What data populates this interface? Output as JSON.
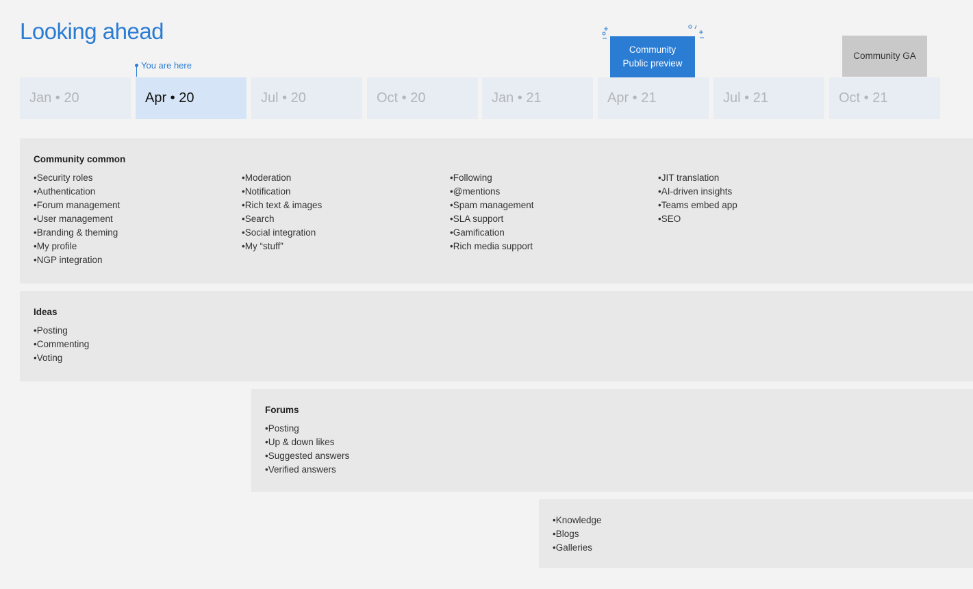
{
  "title": "Looking ahead",
  "timeline": {
    "periods": [
      "Jan • 20",
      "Apr • 20",
      "Jul • 20",
      "Oct • 20",
      "Jan • 21",
      "Apr • 21",
      "Jul • 21",
      "Oct • 21"
    ],
    "current_period": "Apr • 20",
    "you_are_here": "You are here"
  },
  "milestones": {
    "preview": {
      "label": "Community Public preview",
      "color": "#2b7cd3"
    },
    "ga": {
      "label": "Community GA",
      "color": "#c9c9c9"
    }
  },
  "community_common": {
    "title": "Community common",
    "col1": [
      "Security roles",
      "Authentication",
      "Forum management",
      "User management",
      "Branding & theming",
      "My profile",
      "NGP integration"
    ],
    "col2": [
      "Moderation",
      "Notification",
      "Rich text & images",
      "Search",
      "Social integration",
      "My “stuff”"
    ],
    "col3": [
      "Following",
      "@mentions",
      "Spam management",
      "SLA support",
      "Gamification",
      "Rich media support"
    ],
    "col4": [
      "JIT translation",
      "AI-driven insights",
      "Teams embed app",
      "SEO"
    ]
  },
  "ideas": {
    "title": "Ideas",
    "items": [
      "Posting",
      "Commenting",
      "Voting"
    ]
  },
  "forums": {
    "title": "Forums",
    "items": [
      "Posting",
      "Up & down likes",
      "Suggested answers",
      "Verified answers"
    ]
  },
  "content": {
    "items": [
      "Knowledge",
      "Blogs",
      "Galleries"
    ]
  },
  "colors": {
    "accent": "#2b7cd3",
    "band": "#e8e8e8",
    "timeline_cell": "#e8edf3",
    "timeline_current": "#d5e5f7"
  }
}
